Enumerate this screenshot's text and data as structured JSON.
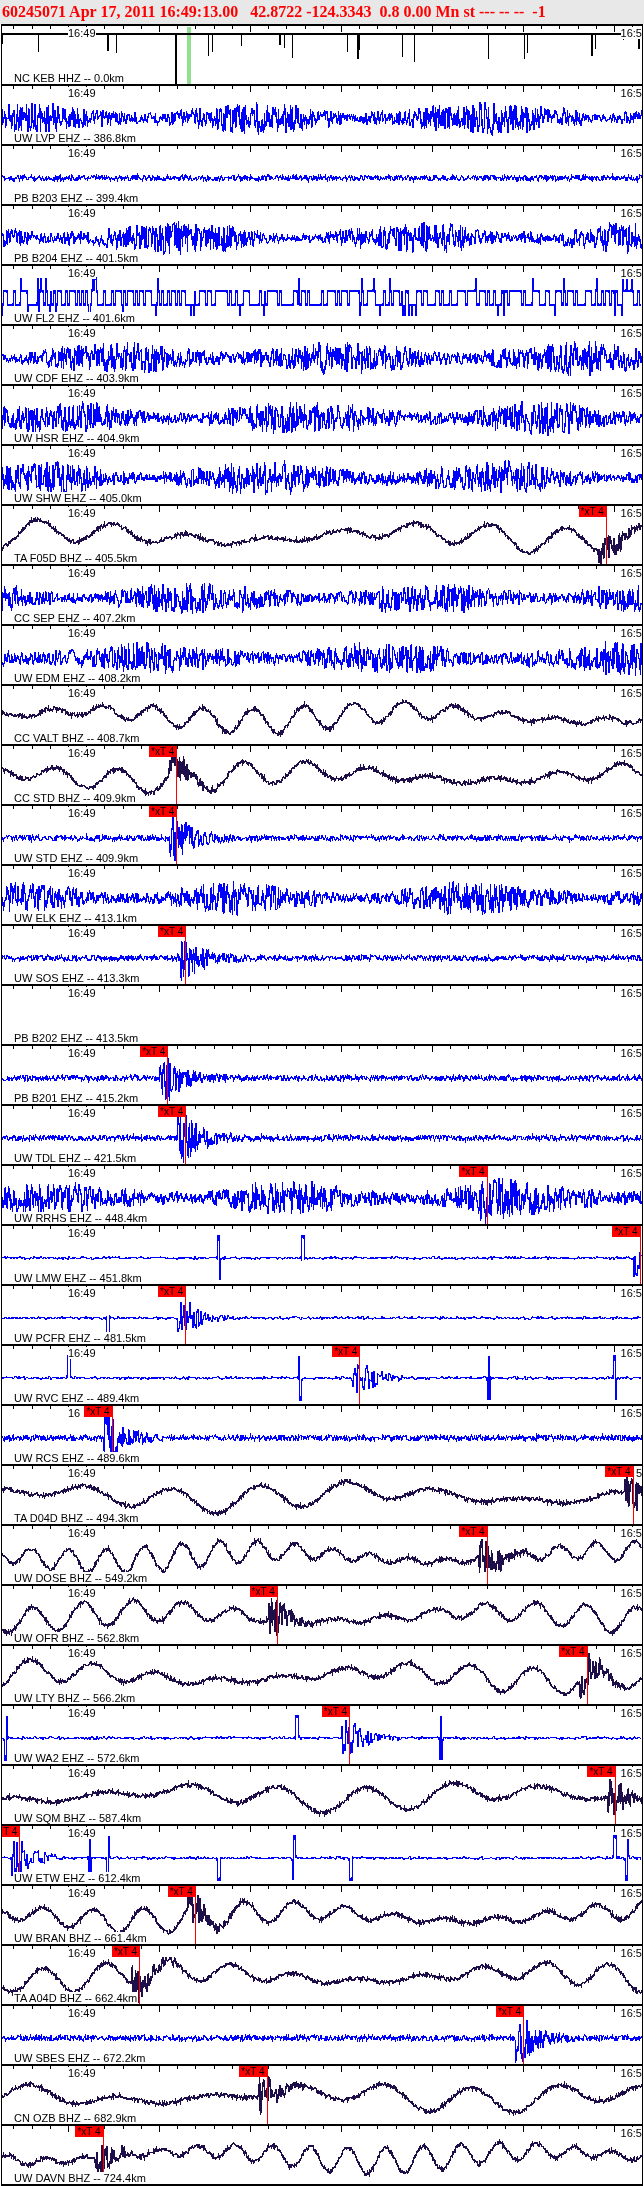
{
  "header": {
    "title": "60245071 Apr 17, 2011 16:49:13.00   42.8722 -124.3343  0.8 0.00 Mn st --- -- --  -1"
  },
  "traces": [
    {
      "label": "NC KEB HHZ -- 0.0km",
      "time_start": "16:49",
      "time_end": "16:5",
      "kind": "reference",
      "color": "#000000"
    },
    {
      "label": "UW LVP EHZ -- 386.8km",
      "time_start": "16:49",
      "time_end": "16:5",
      "kind": "noise",
      "color": "#0000ff"
    },
    {
      "label": "PB B203 EHZ -- 399.4km",
      "time_start": "16:49",
      "time_end": "16:5",
      "kind": "quiet",
      "color": "#0000ff"
    },
    {
      "label": "PB B204 EHZ -- 401.5km",
      "time_start": "16:49",
      "time_end": "16:5",
      "kind": "noise",
      "color": "#0000ff"
    },
    {
      "label": "UW FL2 EHZ -- 401.6km",
      "time_start": "16:49",
      "time_end": "16:5",
      "kind": "square",
      "color": "#0000ff"
    },
    {
      "label": "UW CDF EHZ -- 403.9km",
      "time_start": "16:49",
      "time_end": "16:5",
      "kind": "noise",
      "color": "#0000ff"
    },
    {
      "label": "UW HSR EHZ -- 404.9km",
      "time_start": "16:49",
      "time_end": "16:5",
      "kind": "noise",
      "color": "#0000ff"
    },
    {
      "label": "UW SHW EHZ -- 405.0km",
      "time_start": "16:49",
      "time_end": "16:5",
      "kind": "noise",
      "color": "#0000ff"
    },
    {
      "label": "TA F05D BHZ -- 405.5km",
      "time_start": "16:49",
      "time_end": "16:5",
      "kind": "wave",
      "color": "#1e0f4b",
      "pick": {
        "label": "*xT 4",
        "level": 0.944
      }
    },
    {
      "label": "CC SEP EHZ -- 407.2km",
      "time_start": "16:49",
      "time_end": "16:5",
      "kind": "noise",
      "color": "#0000ff"
    },
    {
      "label": "UW EDM EHZ -- 408.2km",
      "time_start": "16:49",
      "time_end": "16:5",
      "kind": "noise",
      "color": "#0000ff"
    },
    {
      "label": "CC VALT BHZ -- 408.7km",
      "time_start": "16:49",
      "time_end": "16:5",
      "kind": "wave",
      "color": "#1e0f4b"
    },
    {
      "label": "CC STD BHZ -- 409.9km",
      "time_start": "16:49",
      "time_end": "16:5",
      "kind": "wave",
      "color": "#1e0f4b",
      "pick": {
        "label": "*xT 4",
        "level": 0.273
      }
    },
    {
      "label": "UW STD EHZ -- 409.9km",
      "time_start": "16:49",
      "time_end": "16:5",
      "kind": "quiet",
      "color": "#0000ff",
      "pick": {
        "label": "*xT 4",
        "level": 0.273
      }
    },
    {
      "label": "UW ELK EHZ -- 413.1km",
      "time_start": "16:49",
      "time_end": "16:5",
      "kind": "noise",
      "color": "#0000ff"
    },
    {
      "label": "UW SOS EHZ -- 413.3km",
      "time_start": "16:49",
      "time_end": "16:5",
      "kind": "quiet",
      "color": "#0000ff",
      "pick": {
        "label": "*xT 4",
        "level": 0.287
      }
    },
    {
      "label": "PB B202 EHZ -- 413.5km",
      "time_start": "16:49",
      "time_end": "16:5",
      "kind": "blank"
    },
    {
      "label": "PB B201 EHZ -- 415.2km",
      "time_start": "16:49",
      "time_end": "16:5",
      "kind": "quiet",
      "color": "#0000ff",
      "pick": {
        "label": "*xT 4",
        "level": 0.259
      }
    },
    {
      "label": "UW TDL EHZ -- 421.5km",
      "time_start": "16:49",
      "time_end": "16:5",
      "kind": "quiet",
      "color": "#0000ff",
      "pick": {
        "label": "*xT 4",
        "level": 0.287
      }
    },
    {
      "label": "UW RRHS EHZ -- 448.4km",
      "time_start": "16:49",
      "time_end": "16:5",
      "kind": "noise",
      "color": "#0000ff",
      "pick": {
        "label": "*xT 4",
        "level": 0.758
      }
    },
    {
      "label": "UW LMW EHZ -- 451.8km",
      "time_start": "16:49",
      "kind": "spiky",
      "color": "#0000ff",
      "pick": {
        "label": "*xT 4",
        "level": 0.997
      }
    },
    {
      "label": "UW PCFR EHZ -- 481.5km",
      "time_start": "16:49",
      "time_end": "16:5",
      "kind": "spiky",
      "color": "#0000ff",
      "pick": {
        "label": "*xT 4",
        "level": 0.287
      }
    },
    {
      "label": "UW RVC EHZ -- 489.4km",
      "time_start": "16:49",
      "time_end": "16:5",
      "kind": "spiky",
      "color": "#0000ff",
      "pick": {
        "label": "*xT 4",
        "level": 0.559
      }
    },
    {
      "label": "UW RCS EHZ -- 489.6km",
      "time_start": "16",
      "time_end": "16:5",
      "kind": "quiet",
      "color": "#0000ff",
      "pick": {
        "label": "*xT 4",
        "level": 0.172
      }
    },
    {
      "label": "TA D04D BHZ -- 494.3km",
      "time_start": "16:49",
      "time_end": "5",
      "kind": "wave",
      "color": "#1e0f4b",
      "pick": {
        "label": "*xT 4",
        "level": 0.986
      }
    },
    {
      "label": "UW DOSE BHZ -- 549.2km",
      "time_start": "16:49",
      "time_end": "16:5",
      "kind": "wave",
      "color": "#1e0f4b",
      "pick": {
        "label": "*xT 4",
        "level": 0.758
      }
    },
    {
      "label": "UW OFR BHZ -- 562.8km",
      "time_start": "16:49",
      "time_end": "16:5",
      "kind": "wave",
      "color": "#1e0f4b",
      "pick": {
        "label": "*xT 4",
        "level": 0.43
      }
    },
    {
      "label": "UW LTY BHZ -- 566.2km",
      "time_start": "16:49",
      "time_end": "16:5",
      "kind": "wave",
      "color": "#1e0f4b",
      "pick": {
        "label": "*xT 4",
        "level": 0.914
      }
    },
    {
      "label": "UW WA2 EHZ -- 572.6km",
      "time_start": "16:49",
      "time_end": "16:5",
      "kind": "spiky",
      "color": "#0000ff",
      "pick": {
        "label": "*xT 4",
        "level": 0.543
      }
    },
    {
      "label": "UW SQM BHZ -- 587.4km",
      "time_start": "16:49",
      "time_end": "16:5",
      "kind": "wave",
      "color": "#1e0f4b",
      "pick": {
        "label": "*xT 4",
        "level": 0.958
      }
    },
    {
      "label": "UW ETW EHZ -- 612.4km",
      "time_start": "16:49",
      "time_end": "16:5",
      "kind": "spiky",
      "color": "#0000ff",
      "pick": {
        "label": "T 4",
        "level": 0.028
      }
    },
    {
      "label": "UW BRAN BHZ -- 661.4km",
      "time_start": "16:49",
      "time_end": "16:5",
      "kind": "wave",
      "color": "#1e0f4b",
      "pick": {
        "label": "*xT 4",
        "level": 0.302
      }
    },
    {
      "label": "TA A04D BHZ -- 662.4km",
      "time_start": "16:49",
      "time_end": "16:5",
      "kind": "wave",
      "color": "#1e0f4b",
      "pick": {
        "label": "*xT 4",
        "level": 0.215
      }
    },
    {
      "label": "UW SBES EHZ -- 672.2km",
      "time_start": "16:49",
      "time_end": "16:5",
      "kind": "quiet",
      "color": "#0000ff",
      "pick": {
        "label": "*xT 4",
        "level": 0.815
      }
    },
    {
      "label": "CN OZB BHZ -- 682.9km",
      "time_start": "16:49",
      "time_end": "16:5",
      "kind": "wave",
      "color": "#1e0f4b",
      "pick": {
        "label": "*xT 4",
        "level": 0.414
      }
    },
    {
      "label": "UW DAVN BHZ -- 724.4km",
      "time_end": "16:5",
      "kind": "wave",
      "color": "#1e0f4b",
      "pick": {
        "label": "*xT 4",
        "level": 0.158
      }
    }
  ]
}
